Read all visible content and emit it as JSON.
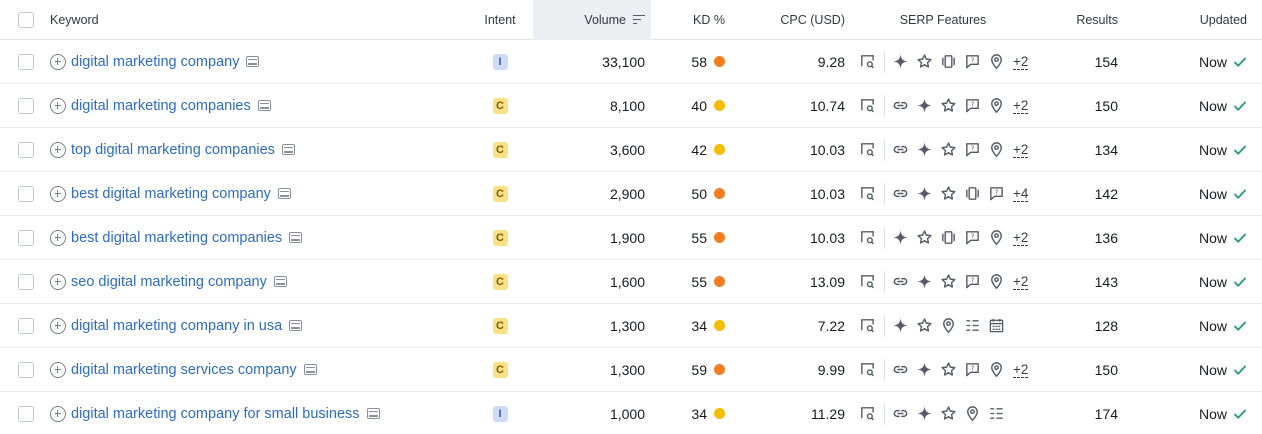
{
  "header": {
    "keyword": "Keyword",
    "intent": "Intent",
    "volume": "Volume",
    "kd": "KD %",
    "cpc": "CPC (USD)",
    "serp": "SERP Features",
    "results": "Results",
    "updated": "Updated"
  },
  "colors": {
    "kd_orange": "#f47c1c",
    "kd_yellow": "#f5bd00",
    "link": "#2d6cc0",
    "check": "#1f9d6c"
  },
  "rows": [
    {
      "keyword": "digital marketing company",
      "intent": "I",
      "volume": "33,100",
      "kd": "58",
      "kd_color": "#f47c1c",
      "cpc": "9.28",
      "serp": [
        "sitelinks-preview-icon",
        "sep",
        "ai-sparkle-icon",
        "star-icon",
        "carousel-icon",
        "faq-icon",
        "location-pin-icon"
      ],
      "more": "+2",
      "results": "154",
      "updated": "Now"
    },
    {
      "keyword": "digital marketing companies",
      "intent": "C",
      "volume": "8,100",
      "kd": "40",
      "kd_color": "#f5bd00",
      "cpc": "10.74",
      "serp": [
        "sitelinks-preview-icon",
        "sep",
        "link-icon",
        "ai-sparkle-icon",
        "star-icon",
        "faq-icon",
        "location-pin-icon"
      ],
      "more": "+2",
      "results": "150",
      "updated": "Now"
    },
    {
      "keyword": "top digital marketing companies",
      "intent": "C",
      "volume": "3,600",
      "kd": "42",
      "kd_color": "#f5bd00",
      "cpc": "10.03",
      "serp": [
        "sitelinks-preview-icon",
        "sep",
        "link-icon",
        "ai-sparkle-icon",
        "star-icon",
        "faq-icon",
        "location-pin-icon"
      ],
      "more": "+2",
      "results": "134",
      "updated": "Now"
    },
    {
      "keyword": "best digital marketing company",
      "intent": "C",
      "volume": "2,900",
      "kd": "50",
      "kd_color": "#f47c1c",
      "cpc": "10.03",
      "serp": [
        "sitelinks-preview-icon",
        "sep",
        "link-icon",
        "ai-sparkle-icon",
        "star-icon",
        "carousel-icon",
        "faq-icon"
      ],
      "more": "+4",
      "results": "142",
      "updated": "Now"
    },
    {
      "keyword": "best digital marketing companies",
      "intent": "C",
      "volume": "1,900",
      "kd": "55",
      "kd_color": "#f47c1c",
      "cpc": "10.03",
      "serp": [
        "sitelinks-preview-icon",
        "sep",
        "ai-sparkle-icon",
        "star-icon",
        "carousel-icon",
        "faq-icon",
        "location-pin-icon"
      ],
      "more": "+2",
      "results": "136",
      "updated": "Now"
    },
    {
      "keyword": "seo digital marketing company",
      "intent": "C",
      "volume": "1,600",
      "kd": "55",
      "kd_color": "#f47c1c",
      "cpc": "13.09",
      "serp": [
        "sitelinks-preview-icon",
        "sep",
        "link-icon",
        "ai-sparkle-icon",
        "star-icon",
        "faq-icon",
        "location-pin-icon"
      ],
      "more": "+2",
      "results": "143",
      "updated": "Now"
    },
    {
      "keyword": "digital marketing company in usa",
      "intent": "C",
      "volume": "1,300",
      "kd": "34",
      "kd_color": "#f5bd00",
      "cpc": "7.22",
      "serp": [
        "sitelinks-preview-icon",
        "sep",
        "ai-sparkle-icon",
        "star-icon",
        "location-pin-icon",
        "list-icon",
        "calendar-icon"
      ],
      "more": "",
      "results": "128",
      "updated": "Now"
    },
    {
      "keyword": "digital marketing services company",
      "intent": "C",
      "volume": "1,300",
      "kd": "59",
      "kd_color": "#f47c1c",
      "cpc": "9.99",
      "serp": [
        "sitelinks-preview-icon",
        "sep",
        "link-icon",
        "ai-sparkle-icon",
        "star-icon",
        "faq-icon",
        "location-pin-icon"
      ],
      "more": "+2",
      "results": "150",
      "updated": "Now"
    },
    {
      "keyword": "digital marketing company for small business",
      "intent": "I",
      "volume": "1,000",
      "kd": "34",
      "kd_color": "#f5bd00",
      "cpc": "11.29",
      "serp": [
        "sitelinks-preview-icon",
        "sep",
        "link-icon",
        "ai-sparkle-icon",
        "star-icon",
        "location-pin-icon",
        "list-icon"
      ],
      "more": "",
      "results": "174",
      "updated": "Now"
    }
  ]
}
